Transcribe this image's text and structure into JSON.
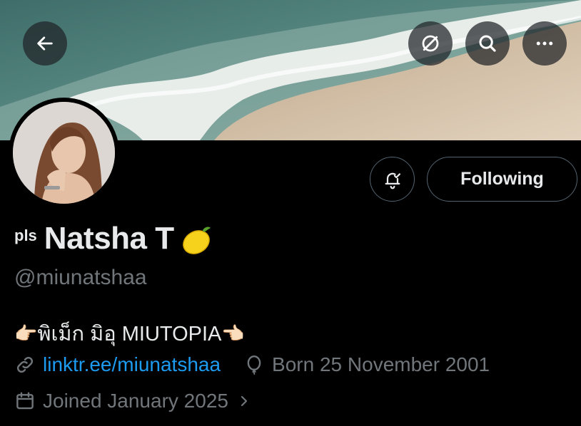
{
  "header": {
    "back_icon": "arrow-left-icon",
    "actions": [
      "grok-icon",
      "search-icon",
      "more-icon"
    ]
  },
  "profile": {
    "name_prefix": "pls",
    "display_name": "Natsha T",
    "name_emoji": "🍋",
    "handle": "@miunatshaa",
    "bio_left_emoji": "👉🏻",
    "bio_text": "พิเม็ก มิอุ MIUTOPIA",
    "bio_right_emoji": "👈🏻",
    "link": "linktr.ee/miunatshaa",
    "birthday": "Born 25 November 2001",
    "joined": "Joined January 2025"
  },
  "buttons": {
    "notify_icon": "bell-check-icon",
    "following_label": "Following"
  },
  "colors": {
    "background": "#000000",
    "text_primary": "#e7e9ea",
    "text_secondary": "#71767b",
    "link": "#1d9bf0",
    "border": "#536471"
  }
}
